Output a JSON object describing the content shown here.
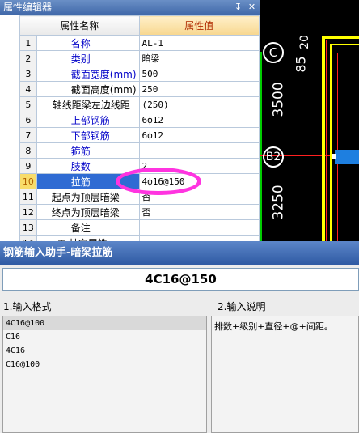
{
  "property_editor": {
    "title": "属性编辑器",
    "pin_icon": "pin-icon",
    "close_icon": "close-icon",
    "columns": {
      "name": "属性名称",
      "value": "属性值"
    },
    "rows": [
      {
        "num": "1",
        "name": "名称",
        "value": "AL-1"
      },
      {
        "num": "2",
        "name": "类别",
        "value": "暗梁"
      },
      {
        "num": "3",
        "name": "截面宽度(mm)",
        "value": "500"
      },
      {
        "num": "4",
        "name": "截面高度(mm)",
        "value": "250"
      },
      {
        "num": "5",
        "name": "轴线距梁左边线距",
        "value": "(250)"
      },
      {
        "num": "6",
        "name": "上部钢筋",
        "value": "6ф12"
      },
      {
        "num": "7",
        "name": "下部钢筋",
        "value": "6ф12"
      },
      {
        "num": "8",
        "name": "箍筋",
        "value": ""
      },
      {
        "num": "9",
        "name": "肢数",
        "value": "2"
      },
      {
        "num": "10",
        "name": "拉筋",
        "value": "4ф16@150"
      },
      {
        "num": "11",
        "name": "起点为顶层暗梁",
        "value": "否"
      },
      {
        "num": "12",
        "name": "终点为顶层暗梁",
        "value": "否"
      },
      {
        "num": "13",
        "name": "备注",
        "value": ""
      },
      {
        "num": "14",
        "name": "其它属性",
        "value": ""
      }
    ],
    "selected_row": "10",
    "colors": {
      "accent": "#2f6bd3",
      "highlight": "#ff34e0",
      "link_text": "#0000c8"
    }
  },
  "cad": {
    "labels": {
      "axis_c": "C",
      "axis_b2": "B2",
      "dim_top": "85",
      "dim_top_small": "20",
      "dim_mid": "3500",
      "dim_bottom": "3250"
    },
    "colors": {
      "yellow": "#ffff00",
      "green": "#00cc00",
      "blue": "#1e7fe0",
      "red": "#ff2020"
    }
  },
  "rebar_helper": {
    "title": "钢筋输入助手-暗梁拉筋",
    "formula": "4C16@150",
    "format_label": "1.输入格式",
    "description_label": "2.输入说明",
    "formats": [
      "4C16@100",
      "C16",
      "4C16",
      "C16@100"
    ],
    "description": "排数+级别+直径+@+间距。"
  }
}
